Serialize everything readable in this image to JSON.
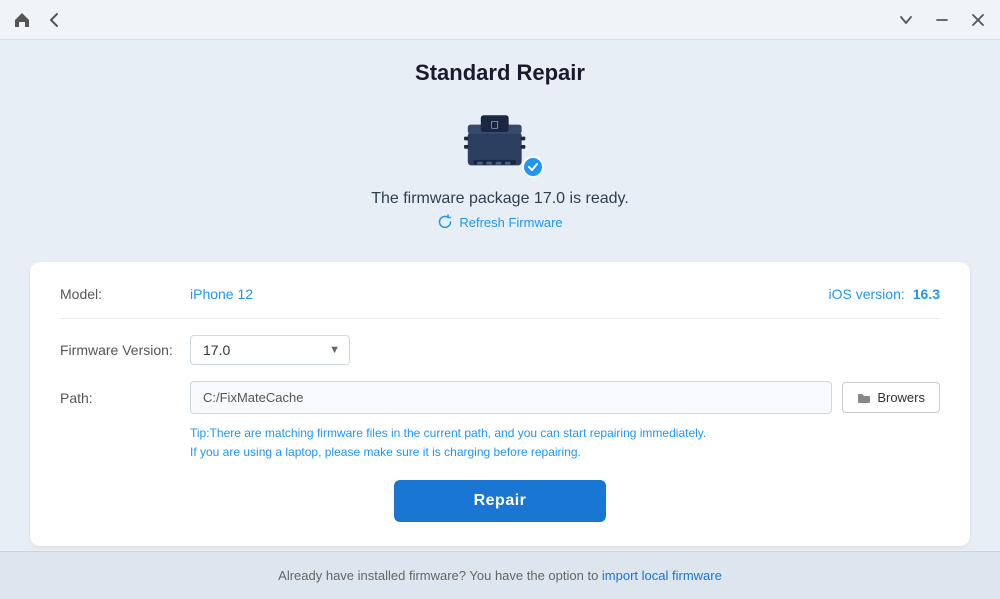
{
  "titlebar": {
    "home_icon": "⌂",
    "back_icon": "←",
    "chevron_down_icon": "⌄",
    "minimize_icon": "−",
    "close_icon": "✕"
  },
  "page": {
    "title": "Standard Repair",
    "firmware_ready_text": "The firmware package 17.0 is ready.",
    "refresh_link": "Refresh Firmware"
  },
  "card": {
    "model_label": "Model:",
    "model_value": "iPhone 12",
    "ios_label": "iOS version:",
    "ios_value": "16.3",
    "firmware_label": "Firmware Version:",
    "firmware_value": "17.0",
    "path_label": "Path:",
    "path_value": "C:/FixMateCache",
    "browsers_btn": "Browers",
    "tip_line1": "Tip:There are matching firmware files in the current path, and you can start repairing immediately.",
    "tip_line2": "If you are using a laptop, please make sure it is charging before repairing.",
    "repair_btn": "Repair"
  },
  "footer": {
    "text": "Already have installed firmware? You have the option to ",
    "link_text": "import local firmware"
  }
}
